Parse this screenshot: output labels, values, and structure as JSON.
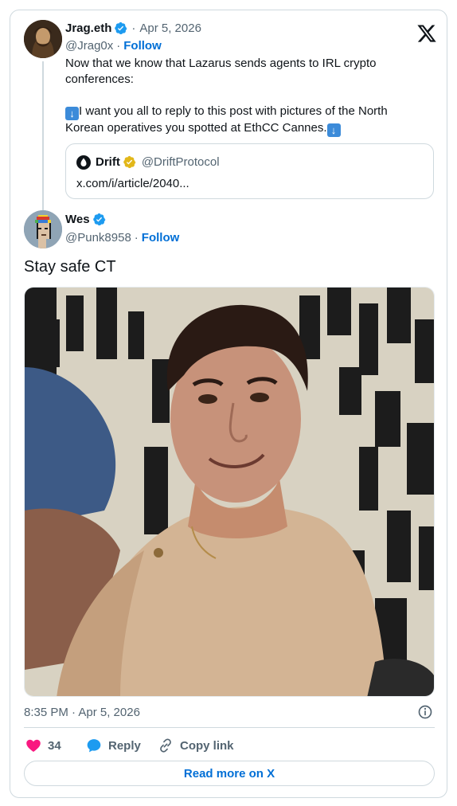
{
  "parent_tweet": {
    "display_name": "Jrag.eth",
    "date": "Apr 5, 2026",
    "separator": "·",
    "handle": "@Jrag0x",
    "follow_label": "Follow",
    "text_line1": "Now that we know that Lazarus sends agents to IRL crypto",
    "text_line2": "conferences:",
    "text_line3": "I want you all to reply to this post with pictures of the North",
    "text_line4": "Korean operatives you spotted at EthCC Cannes.",
    "quote": {
      "display_name": "Drift",
      "handle": "@DriftProtocol",
      "link_text": "x.com/i/article/2040..."
    }
  },
  "reply_tweet": {
    "display_name": "Wes",
    "handle": "@Punk8958",
    "separator": "·",
    "follow_label": "Follow",
    "text": "Stay safe CT",
    "timestamp": "8:35 PM · Apr 5, 2026"
  },
  "actions": {
    "like_count": "34",
    "reply_label": "Reply",
    "copy_link_label": "Copy link",
    "read_more_label": "Read more on X"
  },
  "colors": {
    "link_blue": "#006fd6",
    "verified_blue": "#1d9bf0",
    "verified_gold": "#e2b719",
    "like_pink": "#f91880",
    "text_primary": "#0f1419",
    "text_muted": "#536471",
    "border": "#cfd9de"
  },
  "icons": [
    "x-logo-icon",
    "verified-badge-icon",
    "gold-verified-badge-icon",
    "down-arrow-emoji-icon",
    "drift-logo-icon",
    "info-icon",
    "heart-icon",
    "reply-bubble-icon",
    "link-icon"
  ]
}
